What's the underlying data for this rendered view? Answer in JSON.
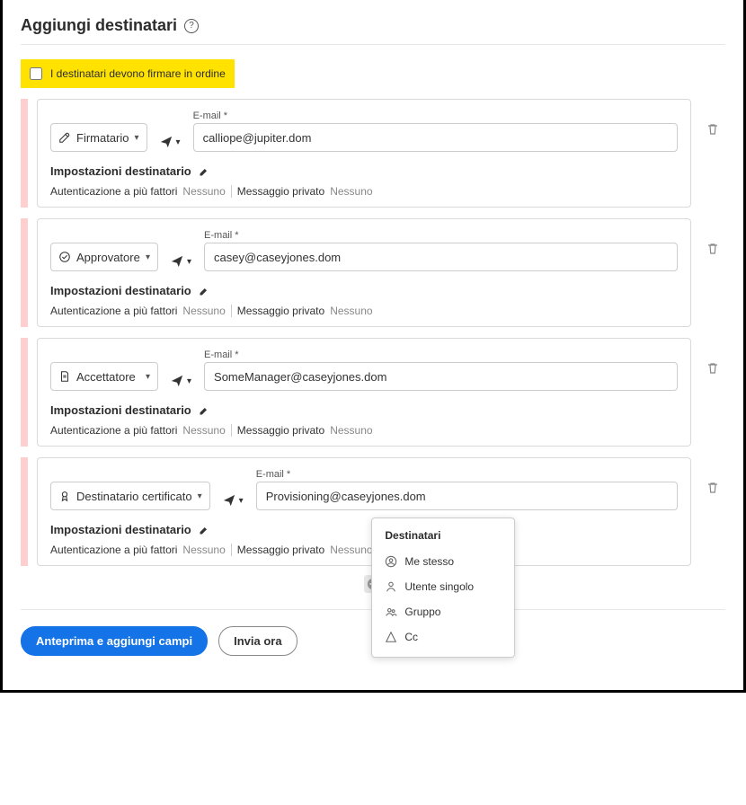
{
  "header": {
    "title": "Aggiungi destinatari"
  },
  "order_checkbox": {
    "label": "I destinatari devono firmare in ordine",
    "checked": false
  },
  "common": {
    "email_label": "E-mail  *",
    "settings_header": "Impostazioni destinatario",
    "mfa_label": "Autenticazione a più fattori",
    "mfa_value": "Nessuno",
    "priv_label": "Messaggio privato",
    "priv_value": "Nessuno"
  },
  "recipients": [
    {
      "role": "Firmatario",
      "role_icon": "pen",
      "email": "calliope@jupiter.dom"
    },
    {
      "role": "Approvatore",
      "role_icon": "check",
      "email": "casey@caseyjones.dom"
    },
    {
      "role": "Accettatore",
      "role_icon": "doc",
      "email": "SomeManager@caseyjones.dom"
    },
    {
      "role": "Destinatario certificato",
      "role_icon": "cert",
      "email": "Provisioning@caseyjones.dom"
    }
  ],
  "popover": {
    "title": "Destinatari",
    "items": [
      {
        "label": "Me stesso",
        "icon": "me"
      },
      {
        "label": "Utente singolo",
        "icon": "user"
      },
      {
        "label": "Gruppo",
        "icon": "group"
      },
      {
        "label": "Cc",
        "icon": "cc"
      }
    ]
  },
  "footer": {
    "primary": "Anteprima e aggiungi campi",
    "secondary": "Invia ora"
  }
}
